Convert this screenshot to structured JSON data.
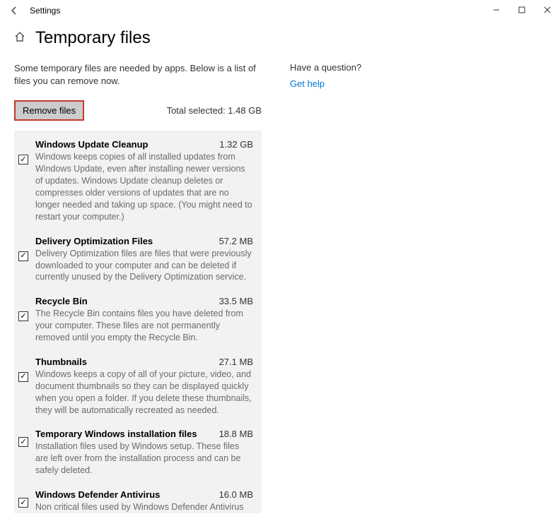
{
  "window": {
    "title": "Settings"
  },
  "page": {
    "heading": "Temporary files",
    "intro": "Some temporary files are needed by apps. Below is a list of files you can remove now.",
    "remove_button": "Remove files",
    "total_label": "Total selected: 1.48 GB"
  },
  "help": {
    "question": "Have a question?",
    "link": "Get help"
  },
  "items": [
    {
      "title": "Windows Update Cleanup",
      "size": "1.32 GB",
      "desc": "Windows keeps copies of all installed updates from Windows Update, even after installing newer versions of updates. Windows Update cleanup deletes or compresses older versions of updates that are no longer needed and taking up space. (You might need to restart your computer.)",
      "checked": true
    },
    {
      "title": "Delivery Optimization Files",
      "size": "57.2 MB",
      "desc": "Delivery Optimization files are files that were previously downloaded to your computer and can be deleted if currently unused by the Delivery Optimization service.",
      "checked": true
    },
    {
      "title": "Recycle Bin",
      "size": "33.5 MB",
      "desc": "The Recycle Bin contains files you have deleted from your computer. These files are not permanently removed until you empty the Recycle Bin.",
      "checked": true
    },
    {
      "title": "Thumbnails",
      "size": "27.1 MB",
      "desc": "Windows keeps a copy of all of your picture, video, and document thumbnails so they can be displayed quickly when you open a folder. If you delete these thumbnails, they will be automatically recreated as needed.",
      "checked": true
    },
    {
      "title": "Temporary Windows installation files",
      "size": "18.8 MB",
      "desc": "Installation files used by Windows setup.  These files are left over from the installation process and can be safely deleted.",
      "checked": true
    },
    {
      "title": "Windows Defender Antivirus",
      "size": "16.0 MB",
      "desc": "Non critical files used by Windows Defender Antivirus",
      "checked": true
    }
  ]
}
